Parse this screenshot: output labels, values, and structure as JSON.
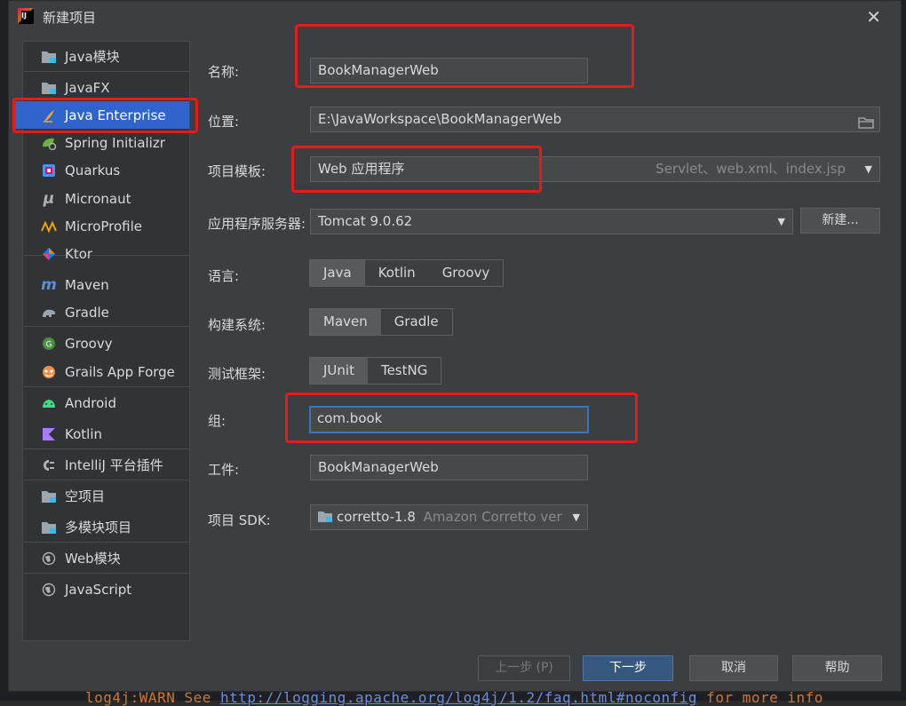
{
  "window": {
    "title": "新建项目"
  },
  "sidebar": {
    "items": [
      {
        "label": "Java模块",
        "icon": "folder-module-icon"
      },
      {
        "label": "JavaFX",
        "icon": "folder-module-icon"
      },
      {
        "label": "Java Enterprise",
        "icon": "java-enterprise-icon",
        "selected": true
      },
      {
        "label": "Spring Initializr",
        "icon": "spring-icon"
      },
      {
        "label": "Quarkus",
        "icon": "quarkus-icon"
      },
      {
        "label": "Micronaut",
        "icon": "micronaut-icon"
      },
      {
        "label": "MicroProfile",
        "icon": "microprofile-icon"
      },
      {
        "label": "Ktor",
        "icon": "ktor-icon"
      },
      {
        "label": "Maven",
        "icon": "maven-icon"
      },
      {
        "label": "Gradle",
        "icon": "gradle-icon"
      },
      {
        "label": "Groovy",
        "icon": "groovy-icon"
      },
      {
        "label": "Grails App Forge",
        "icon": "grails-icon"
      },
      {
        "label": "Android",
        "icon": "android-icon"
      },
      {
        "label": "Kotlin",
        "icon": "kotlin-icon"
      },
      {
        "label": "IntelliJ 平台插件",
        "icon": "plugin-icon"
      },
      {
        "label": "空项目",
        "icon": "folder-module-icon"
      },
      {
        "label": "多模块项目",
        "icon": "folder-module-icon"
      },
      {
        "label": "Web模块",
        "icon": "globe-icon"
      },
      {
        "label": "JavaScript",
        "icon": "globe-icon"
      }
    ]
  },
  "form": {
    "name_label": "名称:",
    "name_value": "BookManagerWeb",
    "location_label": "位置:",
    "location_value": "E:\\JavaWorkspace\\BookManagerWeb",
    "template_label": "项目模板:",
    "template_value": "Web 应用程序",
    "template_hint": "Servlet、web.xml、index.jsp",
    "server_label": "应用程序服务器:",
    "server_value": "Tomcat 9.0.62",
    "server_new_button": "新建...",
    "language_label": "语言:",
    "languages": [
      "Java",
      "Kotlin",
      "Groovy"
    ],
    "build_label": "构建系统:",
    "builds": [
      "Maven",
      "Gradle"
    ],
    "test_label": "测试框架:",
    "tests": [
      "JUnit",
      "TestNG"
    ],
    "group_label": "组:",
    "group_value": "com.book",
    "artifact_label": "工件:",
    "artifact_value": "BookManagerWeb",
    "sdk_label": "项目 SDK:",
    "sdk_value": "corretto-1.8",
    "sdk_hint": "Amazon Corretto ver"
  },
  "footer": {
    "prev": "上一步 (P)",
    "next": "下一步",
    "cancel": "取消",
    "help": "帮助"
  },
  "background": {
    "code_prefix": "log4j:WARN See ",
    "code_url": "http://logging.apache.org/log4j/1.2/faq.html#noconfig",
    "code_suffix": " for more info"
  },
  "colors": {
    "accent": "#2f65ca",
    "highlight": "#e51b1b",
    "primary_button": "#365880"
  }
}
